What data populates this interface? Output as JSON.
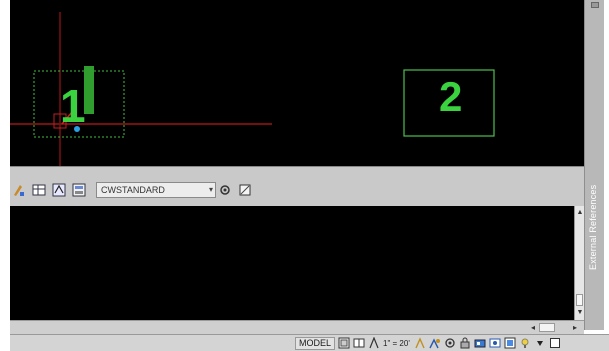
{
  "viewport": {
    "labels": [
      "1",
      "2"
    ]
  },
  "palette": {
    "title": "External References"
  },
  "toolbar": {
    "style_value": "CWSTANDARD",
    "icons": [
      "match-icon",
      "table-icon",
      "dim-style-icon",
      "layer-icon",
      "style-manager-icon",
      "dropdown-settings-icon"
    ]
  },
  "status": {
    "model_label": "MODEL",
    "annotation_scale": "1\" = 20'",
    "icons": [
      "layout-icon",
      "viewport-icon",
      "annotation-visibility-icon",
      "auto-scale-icon",
      "workspace-icon",
      "lock-icon",
      "hardware-accel-icon",
      "isolate-icon",
      "clean-screen-icon"
    ]
  },
  "colors": {
    "canvas_bg": "#000000",
    "label_green": "#3ad23f",
    "viewport_border": "#5ad05a",
    "crosshair": "#b01818"
  }
}
